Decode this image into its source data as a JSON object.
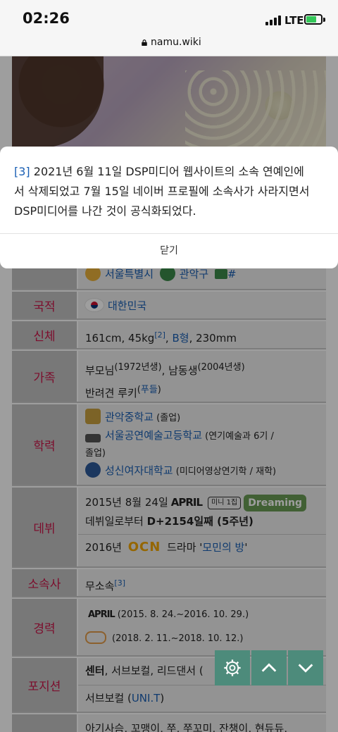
{
  "status": {
    "time": "02:26",
    "network": "LTE"
  },
  "browser": {
    "url": "namu.wiki"
  },
  "modal": {
    "ref": "[3]",
    "text_lines": [
      " 2021년 6월 11일 DSP미디어 웹사이트의 소속 연예인에",
      "서 삭제되었고 7월 15일 네이버 프로필에 소속사가 사라지면서",
      "DSP미디어를 나간 것이 공식화되었다."
    ],
    "close_label": "닫기"
  },
  "table": {
    "birthplace": {
      "city": "서울특별시",
      "district": "관악구",
      "link": "#"
    },
    "nationality": {
      "label": "국적",
      "value": "대한민국"
    },
    "body": {
      "label": "신체",
      "height_weight": "161cm, 45kg",
      "ref": "[2]",
      "sep": ", ",
      "blood": "B형",
      "foot": ", 230mm"
    },
    "family": {
      "label": "가족",
      "line1a": "부모님",
      "line1b": "(1972년생)",
      "line1c": ", 남동생",
      "line1d": "(2004년생)",
      "line2a": "반려견 루키",
      "line2b": "(",
      "line2c": "푸들",
      "line2d": ")"
    },
    "education": {
      "label": "학력",
      "s1": "관악중학교",
      "s1note": " (졸업)",
      "s2": "서울공연예술고등학교",
      "s2note": " (연기예술과 6기 /",
      "s2note2": "졸업)",
      "s3": "성신여자대학교",
      "s3note": " (미디어영상연기학 / 재학)"
    },
    "debut": {
      "label": "데뷔",
      "date": "2015년 8월 24일",
      "group_logo": "APRIL",
      "mini_tag": "미니 1집",
      "album": "Dreaming",
      "days_a": "데뷔일로부터 ",
      "days_b": "D+2154일째 (5주년)",
      "drama_a": "2016년 ",
      "drama_logo": "OCN",
      "drama_b": " 드라마 '",
      "drama_title": "모민의 방",
      "drama_c": "'"
    },
    "agency": {
      "label": "소속사",
      "value": "무소속",
      "ref": "[3]"
    },
    "career": {
      "label": "경력",
      "c1": "(2015. 8. 24.~2016. 10. 29.)",
      "c2": "(2018. 2. 11.~2018. 10. 12.)",
      "logo1": "APRIL"
    },
    "position": {
      "label": "포지션",
      "line1a": "센터",
      "line1b": ", 서브보컬, 리드댄서 (",
      "line2a": "서브보컬 (",
      "line2b": "UNI.T",
      "line2c": ")"
    },
    "nickname": {
      "value": "아기사슴, 꼬맹이, 쭈, 쭈꼬미, 잔챙이, 현듀듀,"
    }
  },
  "colors": {
    "label_text": "#c9184a",
    "link": "#1a5fb4",
    "fab": "#4d8b7b",
    "dreaming": "#6a9b55"
  },
  "icons": [
    "lock-icon",
    "settings-gear-icon",
    "chevron-up-icon",
    "chevron-down-icon"
  ]
}
